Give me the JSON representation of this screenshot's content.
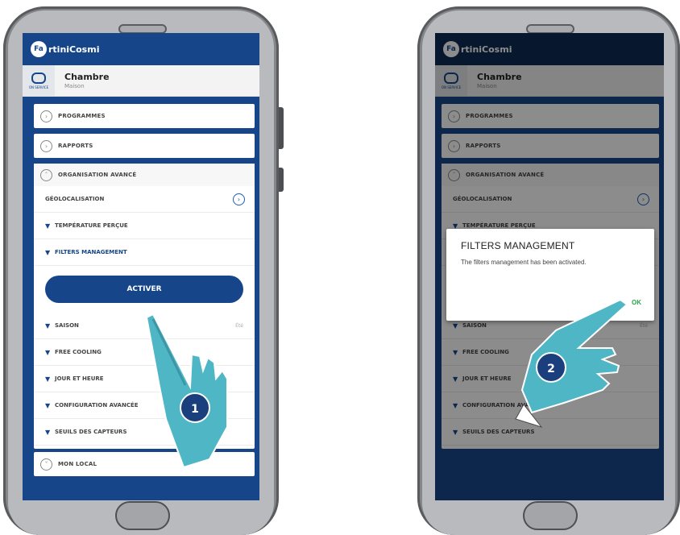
{
  "brand": {
    "logo_text": "Fa",
    "name_text": "rtiniCosmi"
  },
  "room": {
    "icon_caption": "ON SERVICE",
    "name": "Chambre",
    "subtitle": "Maison"
  },
  "menu": {
    "programmes": "PROGRAMMES",
    "rapports": "RAPPORTS",
    "organisation": "ORGANISATION AVANCÉ",
    "geolocalisation": "GÉOLOCALISATION",
    "temperature": "TEMPÉRATURE PERÇUE",
    "filters": "FILTERS MANAGEMENT",
    "activer": "ACTIVER",
    "saison": "SAISON",
    "saison_value": "Été",
    "free_cooling": "FREE COOLING",
    "jour": "JOUR ET HEURE",
    "config": "CONFIGURATION AVANCÉE",
    "seuils": "SEUILS DES CAPTEURS",
    "mon_local": "MON LOCAL"
  },
  "dialog": {
    "title": "FILTERS MANAGEMENT",
    "message": "The filters management has been activated.",
    "ok": "OK"
  },
  "steps": {
    "step1": "1",
    "step2": "2"
  },
  "colors": {
    "brand_blue": "#16458a",
    "hand": "#4fb6c5",
    "ok_green": "#2aa34a"
  }
}
